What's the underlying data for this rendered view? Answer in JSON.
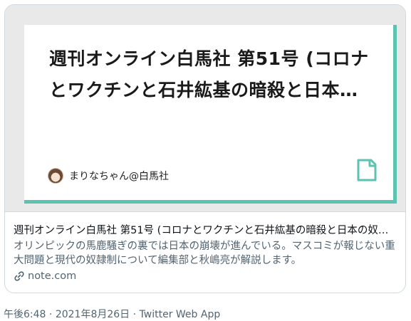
{
  "card": {
    "image_title": "週刊オンライン白馬社 第51号 (コロナとワクチンと石井紘基の暗殺と日本…",
    "author": "まりなちゃん@白馬社",
    "accent_color": "#5ec2b0",
    "title": "週刊オンライン白馬社 第51号 (コロナとワクチンと石井紘基の暗殺と日本の奴…",
    "description": "オリンピックの馬鹿騒ぎの裏では日本の崩壊が進んでいる。マスコミが報じない重大問題と現代の奴隷制について編集部と秋嶋亮が解説します。",
    "domain": "note.com"
  },
  "tweet_meta": {
    "time": "午後6:48",
    "separator": "·",
    "date": "2021年8月26日",
    "source": "Twitter Web App"
  },
  "icons": {
    "avatar": "author-avatar",
    "note": "note-logo-icon",
    "link": "link-icon"
  }
}
